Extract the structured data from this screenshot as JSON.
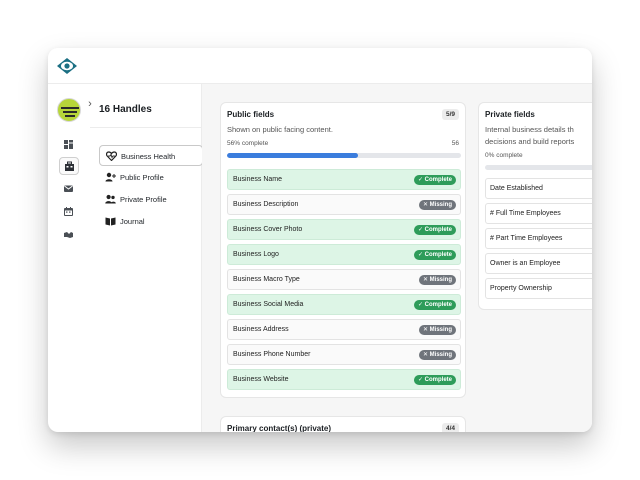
{
  "app": {
    "logo_icon": "eye-logo-icon"
  },
  "rail": {
    "icons": [
      "dashboard-icon",
      "business-icon",
      "mail-icon",
      "calendar-icon",
      "handshake-icon"
    ]
  },
  "subnav": {
    "title": "16 Handles",
    "items": [
      {
        "label": "Business Health",
        "icon": "heart-pulse-icon"
      },
      {
        "label": "Public Profile",
        "icon": "user-plus-icon"
      },
      {
        "label": "Private Profile",
        "icon": "users-icon"
      },
      {
        "label": "Journal",
        "icon": "book-icon"
      }
    ]
  },
  "public_card": {
    "title": "Public fields",
    "count": "5/9",
    "description": "Shown on public facing content.",
    "progress_label": "56% complete",
    "progress_value": "56",
    "progress_fraction": 0.56,
    "fields": [
      {
        "name": "Business Name",
        "status": "Complete"
      },
      {
        "name": "Business Description",
        "status": "Missing"
      },
      {
        "name": "Business Cover Photo",
        "status": "Complete"
      },
      {
        "name": "Business Logo",
        "status": "Complete"
      },
      {
        "name": "Business Macro Type",
        "status": "Missing"
      },
      {
        "name": "Business Social Media",
        "status": "Complete"
      },
      {
        "name": "Business Address",
        "status": "Missing"
      },
      {
        "name": "Business Phone Number",
        "status": "Missing"
      },
      {
        "name": "Business Website",
        "status": "Complete"
      }
    ]
  },
  "private_card": {
    "title": "Private fields",
    "description_line1": "Internal business details th",
    "description_line2": "decisions and build reports",
    "progress_label": "0% complete",
    "progress_fraction": 0,
    "fields": [
      {
        "name": "Date Established"
      },
      {
        "name": "# Full Time Employees"
      },
      {
        "name": "# Part Time Employees"
      },
      {
        "name": "Owner is an Employee"
      },
      {
        "name": "Property Ownership"
      }
    ]
  },
  "contacts_card": {
    "title": "Primary contact(s) (private)",
    "count": "4/4"
  },
  "colors": {
    "brand": "#1b6f83",
    "progress": "#3b7ddd",
    "complete_badge": "#2e9c5a",
    "missing_badge": "#6f747b",
    "complete_row": "#ddf5e6"
  }
}
